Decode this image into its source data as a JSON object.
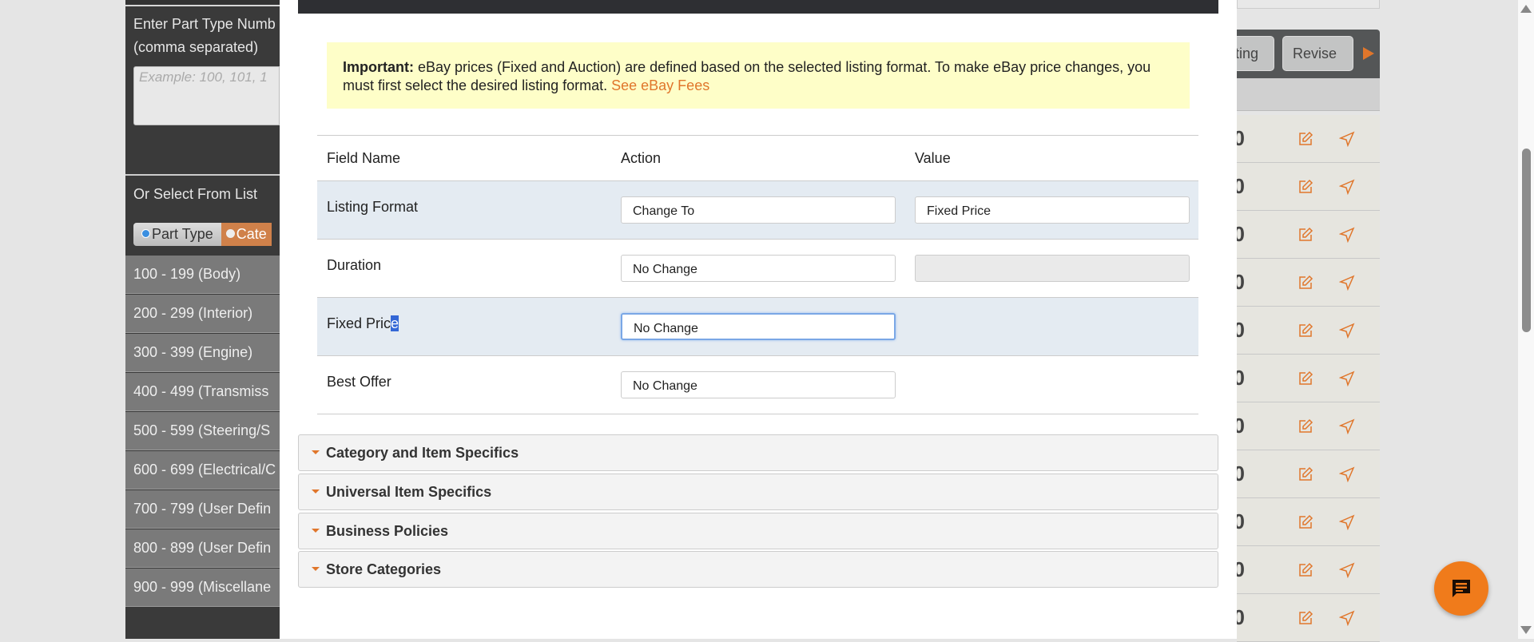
{
  "sidebar": {
    "part_type_label": "Enter Part Type Numb",
    "part_type_label_2": "(comma separated)",
    "textarea_placeholder": "Example: 100, 101, 1",
    "select_label": "Or Select From List",
    "toggle": {
      "part_type": "Part Type",
      "category": "Cate"
    },
    "items": [
      "100 - 199 (Body)",
      "200 - 299 (Interior)",
      "300 - 399 (Engine)",
      "400 - 499 (Transmiss",
      "500 - 599 (Steering/S",
      "600 - 699 (Electrical/C",
      "700 - 799 (User Defin",
      "800 - 899 (User Defin",
      "900 - 999 (Miscellane"
    ]
  },
  "modal": {
    "notice": {
      "bold": "Important:",
      "text": " eBay prices (Fixed and Auction) are defined based on the selected listing format. To make eBay price changes, you must first select the desired listing format. ",
      "link": "See eBay Fees"
    },
    "columns": [
      "Field Name",
      "Action",
      "Value"
    ],
    "rows": [
      {
        "field": "Listing Format",
        "action": "Change To",
        "value": "Fixed Price"
      },
      {
        "field": "Duration",
        "action": "No Change",
        "value": ""
      },
      {
        "field_a": "Fixed Pric",
        "field_sel": "e",
        "action": "No Change"
      },
      {
        "field": "Best Offer",
        "action": "No Change"
      }
    ],
    "sections": [
      "Category and Item Specifics",
      "Universal Item Specifics",
      "Business Policies",
      "Store Categories"
    ]
  },
  "right": {
    "buttons": [
      "ting",
      "Revise"
    ],
    "row_value": "0"
  },
  "colors": {
    "accent": "#e0762b",
    "chat": "#f07b1b"
  }
}
